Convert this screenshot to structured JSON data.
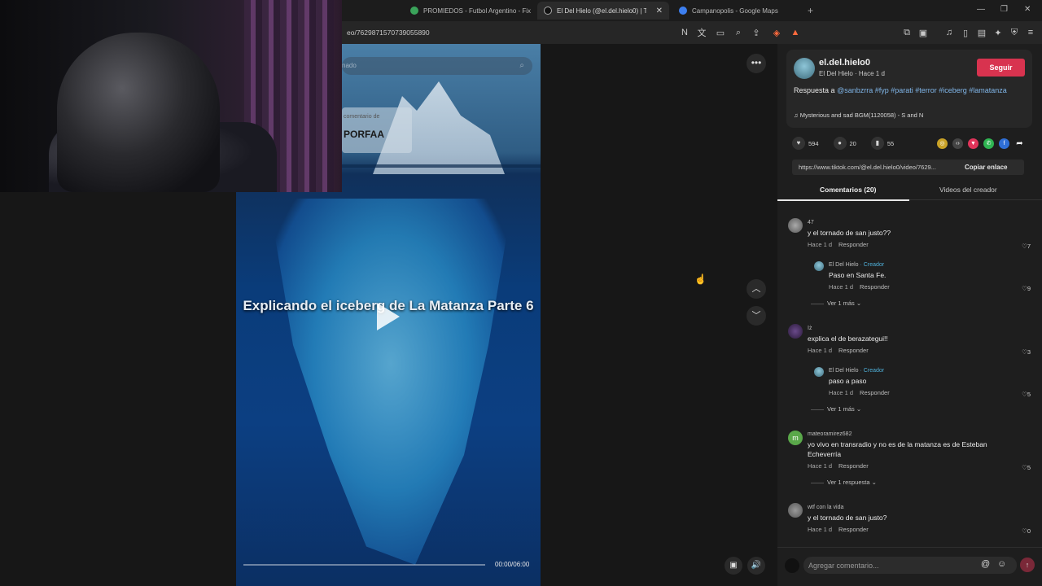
{
  "browser": {
    "tabs": [
      {
        "label": "PROMIEDOS - Futbol Argentino - Fix",
        "favicon_color": "#3aa35a"
      },
      {
        "label": "El Del Hielo (@el.del.hielo0) | Tik",
        "favicon_color": "#111111"
      },
      {
        "label": "Campanopolis - Google Maps",
        "favicon_color": "#3d7ff0"
      }
    ],
    "tab_close": "✕",
    "new_tab": "+",
    "url": "eo/7629871570739055890",
    "window_controls": [
      "—",
      "❐",
      "✕"
    ]
  },
  "video": {
    "search_placeholder": "nado",
    "comment_label": "comentario de",
    "comment_big": "PORFAA",
    "title": "Explicando el iceberg de La Matanza Parte 6",
    "time": "00:00/06:00",
    "progress": 0
  },
  "author": {
    "username": "el.del.hielo0",
    "subline": "El Del Hielo · Hace 1 d",
    "follow_label": "Seguir",
    "desc_prefix": "Respuesta a",
    "desc_tags": "@sanbzrra #fyp #parati #terror #iceberg #lamatanza",
    "music": "Mysterious and sad BGM(1120058) - S and N"
  },
  "stats": {
    "likes": "594",
    "comments": "20",
    "saves": "55"
  },
  "link": {
    "url": "https://www.tiktok.com/@el.del.hielo0/video/7629...",
    "copy_label": "Copiar enlace"
  },
  "panel_tabs": {
    "comments": "Comentarios (20)",
    "creator_videos": "Videos del creador"
  },
  "comments": [
    {
      "user": "47",
      "text": "y el tornado de san justo??",
      "time": "Hace 1 d",
      "reply": "Responder",
      "likes": "7",
      "reply_item": {
        "user": "El Del Hielo",
        "badge": "· Creador",
        "text": "Paso en Santa Fe.",
        "time": "Hace 1 d",
        "reply": "Responder",
        "likes": "9"
      },
      "more": "Ver 1 más"
    },
    {
      "user": "ïż",
      "text": "explica el de berazategui!!",
      "time": "Hace 1 d",
      "reply": "Responder",
      "likes": "3",
      "reply_item": {
        "user": "El Del Hielo",
        "badge": "· Creador",
        "text": "paso a paso",
        "time": "Hace 1 d",
        "reply": "Responder",
        "likes": "5"
      },
      "more": "Ver 1 más"
    },
    {
      "user": "mateoramirez682",
      "text": "yo vivo en transradio y no es de la matanza es de Esteban Echeverría",
      "time": "Hace 1 d",
      "reply": "Responder",
      "likes": "5",
      "more": "Ver 1 respuesta",
      "avatar_letter": "m"
    },
    {
      "user": "wtf con la vida",
      "text": "y el tornado de san justo?",
      "time": "Hace 1 d",
      "reply": "Responder",
      "likes": "0"
    }
  ],
  "comment_input": {
    "placeholder": "Agregar comentario..."
  },
  "icons": {
    "more": "•••",
    "up": "︿",
    "down": "﹀",
    "heart": "♥",
    "bubble": "●",
    "bookmark": "▮",
    "music": "♫",
    "like_outline": "♡",
    "at": "@",
    "emoji": "☺",
    "send": "↑",
    "volume": "🔊",
    "pip": "▣",
    "search": "⌕"
  }
}
